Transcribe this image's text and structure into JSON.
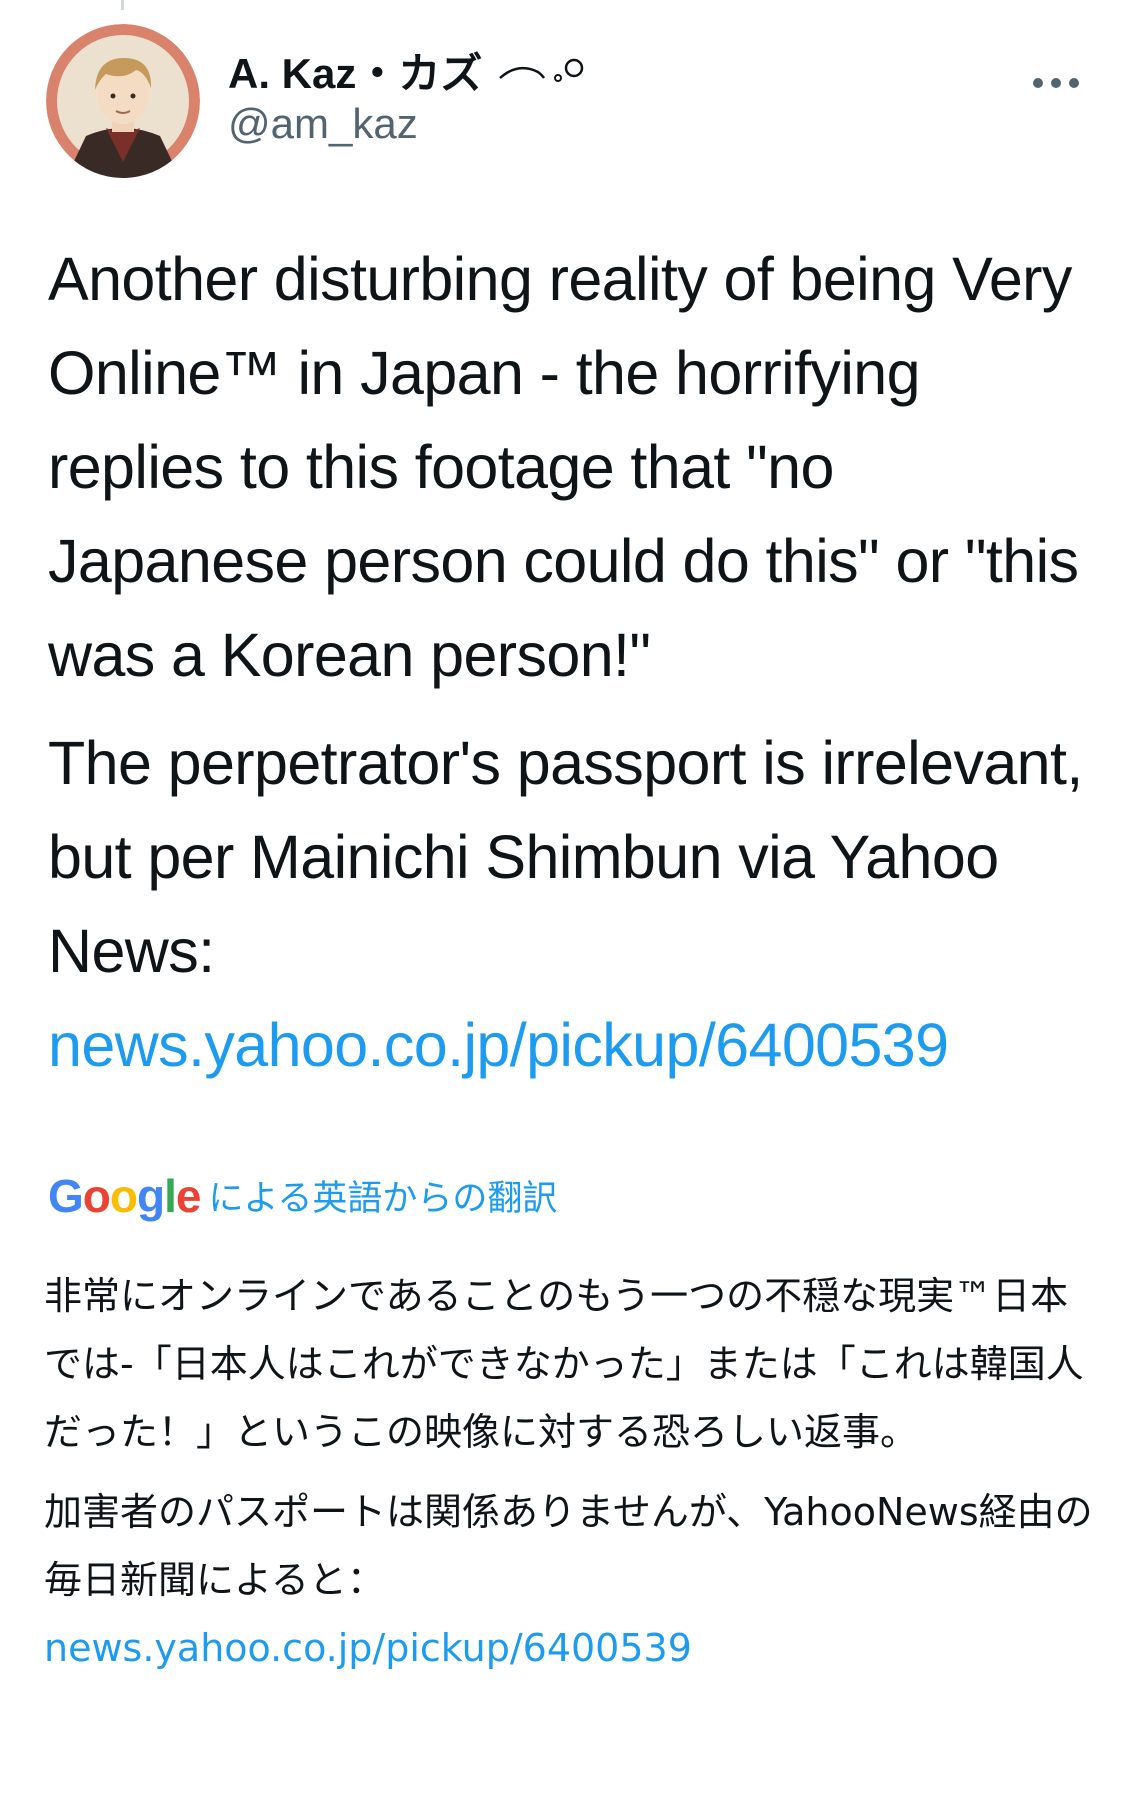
{
  "tweet": {
    "author": {
      "display_name": "A. Kaz・カズ",
      "handle": "@am_kaz",
      "avatar": "avatar-illustration"
    },
    "more_icon": "more-horizontal-icon",
    "paragraphs": [
      {
        "text": "Another disturbing reality of being Very Online™ in Japan - the horrifying replies to this footage that \"no Japanese person could do this\" or \"this was a Korean person!\""
      },
      {
        "text": "The perpetrator's passport is irrelevant, but per Mainichi Shimbun via Yahoo News: ",
        "link": "news.yahoo.co.jp/pickup/6400539"
      }
    ]
  },
  "translation": {
    "provider": "Google",
    "label": "による英語からの翻訳",
    "paragraphs": [
      {
        "text": "非常にオンラインであることのもう一つの不穏な現実™日本では-「日本人はこれができなかった」または「これは韓国人だった！」というこの映像に対する恐ろしい返事。"
      },
      {
        "text": "加害者のパスポートは関係ありませんが、YahooNews経由の毎日新聞によると：",
        "link": "news.yahoo.co.jp/pickup/6400539"
      }
    ]
  },
  "colors": {
    "text": "#0f1419",
    "secondary": "#536471",
    "link": "#1d9bf0"
  }
}
